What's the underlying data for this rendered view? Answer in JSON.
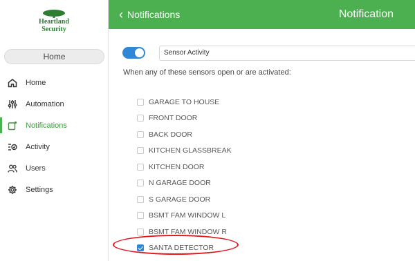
{
  "brand": {
    "line1": "Heartland",
    "line2": "Security",
    "accent": "#2e7d32"
  },
  "sidebar": {
    "home_pill": "Home",
    "items": [
      {
        "label": "Home",
        "icon": "house-icon"
      },
      {
        "label": "Automation",
        "icon": "sliders-icon"
      },
      {
        "label": "Notifications",
        "icon": "notification-icon",
        "active": true
      },
      {
        "label": "Activity",
        "icon": "activity-list-icon"
      },
      {
        "label": "Users",
        "icon": "users-icon"
      },
      {
        "label": "Settings",
        "icon": "gear-icon"
      }
    ]
  },
  "header": {
    "back_label": "Notifications",
    "title": "Notification",
    "color": "#4caf50"
  },
  "main": {
    "toggle_on": true,
    "select_value": "Sensor Activity",
    "prompt": "When any of these sensors open or are activated:",
    "sensors": [
      {
        "label": "GARAGE TO HOUSE",
        "checked": false
      },
      {
        "label": "FRONT DOOR",
        "checked": false
      },
      {
        "label": "BACK DOOR",
        "checked": false
      },
      {
        "label": "KITCHEN GLASSBREAK",
        "checked": false
      },
      {
        "label": "KITCHEN DOOR",
        "checked": false
      },
      {
        "label": "N GARAGE DOOR",
        "checked": false
      },
      {
        "label": "S GARAGE DOOR",
        "checked": false
      },
      {
        "label": "BSMT FAM WINDOW L",
        "checked": false
      },
      {
        "label": "BSMT FAM WINDOW R",
        "checked": false
      },
      {
        "label": "SANTA DETECTOR",
        "checked": true
      }
    ]
  },
  "colors": {
    "toggle": "#2f87d6",
    "highlight": "#e1191e"
  }
}
